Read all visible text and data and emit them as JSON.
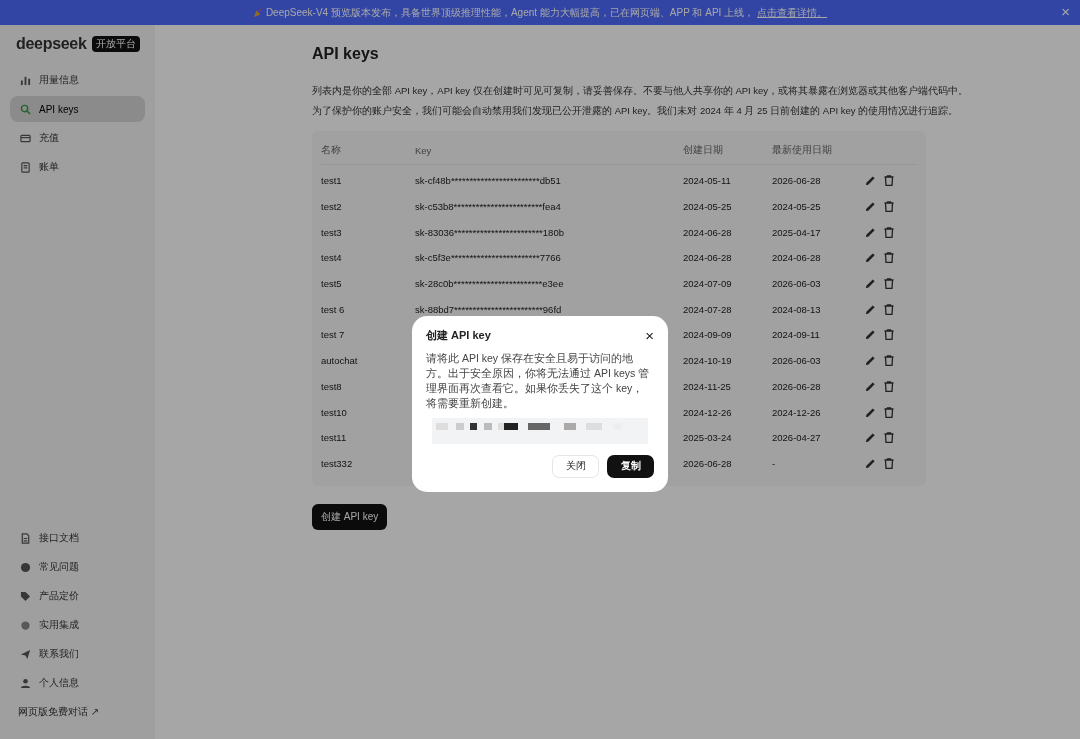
{
  "banner": {
    "text": "DeepSeek-V4 预览版本发布，具备世界顶级推理性能，Agent 能力大幅提高，已在网页端、APP 和 API 上线，",
    "link": "点击查看详情。",
    "close": "×"
  },
  "sidebar": {
    "logo": "deepseek",
    "badge": "开放平台",
    "top_items": [
      {
        "label": "用量信息",
        "selected": false
      },
      {
        "label": "API keys",
        "selected": true
      },
      {
        "label": "充值",
        "selected": false
      },
      {
        "label": "账单",
        "selected": false
      }
    ],
    "bottom_items": [
      {
        "label": "接口文档"
      },
      {
        "label": "常见问题"
      },
      {
        "label": "产品定价"
      },
      {
        "label": "实用集成"
      },
      {
        "label": "联系我们"
      },
      {
        "label": "个人信息"
      }
    ],
    "web_link": "网页版免费对话 ↗"
  },
  "page": {
    "title": "API keys",
    "description": [
      "列表内是你的全部 API key，API key 仅在创建时可见可复制，请妥善保存。不要与他人共享你的 API key，或将其暴露在浏览器或其他客户端代码中。",
      "为了保护你的账户安全，我们可能会自动禁用我们发现已公开泄露的 API key。我们未对 2024 年 4 月 25 日前创建的 API key 的使用情况进行追踪。"
    ],
    "table": {
      "columns": [
        "名称",
        "Key",
        "创建日期",
        "最新使用日期"
      ],
      "rows": [
        {
          "name": "test1",
          "key": "sk-cf48b************************db51",
          "created": "2024-05-11",
          "last_used": "2026-06-28"
        },
        {
          "name": "test2",
          "key": "sk-c53b8************************fea4",
          "created": "2024-05-25",
          "last_used": "2024-05-25"
        },
        {
          "name": "test3",
          "key": "sk-83036************************180b",
          "created": "2024-06-28",
          "last_used": "2025-04-17"
        },
        {
          "name": "test4",
          "key": "sk-c5f3e************************7766",
          "created": "2024-06-28",
          "last_used": "2024-06-28"
        },
        {
          "name": "test5",
          "key": "sk-28c0b************************e3ee",
          "created": "2024-07-09",
          "last_used": "2026-06-03"
        },
        {
          "name": "test 6",
          "key": "sk-88bd7************************96fd",
          "created": "2024-07-28",
          "last_used": "2024-08-13"
        },
        {
          "name": "test 7",
          "created": "2024-09-09",
          "last_used": "2024-09-11"
        },
        {
          "name": "autochat",
          "created": "2024-10-19",
          "last_used": "2026-06-03"
        },
        {
          "name": "test8",
          "created": "2024-11-25",
          "last_used": "2026-06-28"
        },
        {
          "name": "test10",
          "created": "2024-12-26",
          "last_used": "2024-12-26"
        },
        {
          "name": "test11",
          "created": "2025-03-24",
          "last_used": "2026-04-27"
        },
        {
          "name": "test332",
          "created": "2026-06-28",
          "last_used": "-"
        }
      ]
    },
    "create_button": "创建 API key"
  },
  "dialog": {
    "title": "创建 API key",
    "close": "×",
    "message": "请将此 API key 保存在安全且易于访问的地方。出于安全原因，你将无法通过 API keys 管理界面再次查看它。如果你丢失了这个 key，将需要重新创建。",
    "buttons": [
      {
        "label": "关闭",
        "kind": "secondary"
      },
      {
        "label": "复制",
        "kind": "primary"
      }
    ]
  }
}
